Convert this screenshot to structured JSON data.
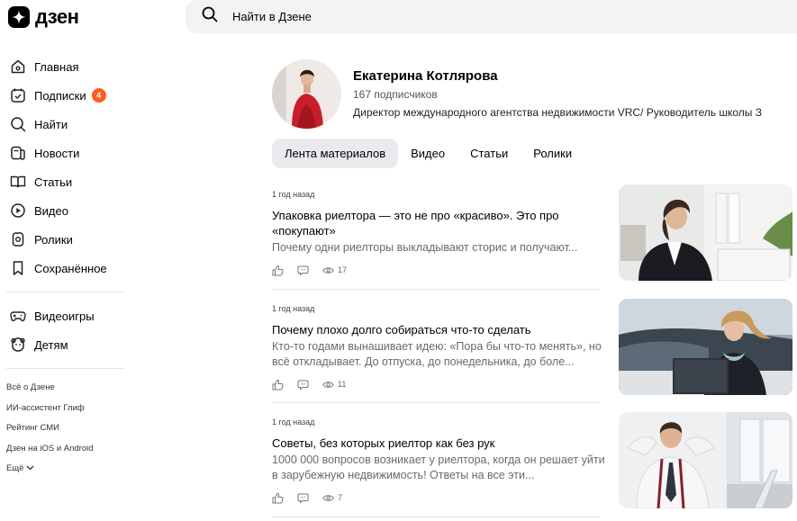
{
  "header": {
    "logo_text": "дзен",
    "search_placeholder": "Найти в Дзене"
  },
  "sidebar": {
    "items": [
      {
        "label": "Главная",
        "icon": "home-icon"
      },
      {
        "label": "Подписки",
        "icon": "subscriptions-icon",
        "badge": "4"
      },
      {
        "label": "Найти",
        "icon": "search-icon"
      },
      {
        "label": "Новости",
        "icon": "news-icon"
      },
      {
        "label": "Статьи",
        "icon": "articles-icon"
      },
      {
        "label": "Видео",
        "icon": "video-icon"
      },
      {
        "label": "Ролики",
        "icon": "shorts-icon"
      },
      {
        "label": "Сохранённое",
        "icon": "bookmark-icon"
      }
    ],
    "extra_items": [
      {
        "label": "Видеоигры",
        "icon": "gamepad-icon"
      },
      {
        "label": "Детям",
        "icon": "kids-icon"
      }
    ],
    "footer_links": [
      "Всё о Дзене",
      "ИИ-ассистент Глиф",
      "Рейтинг СМИ",
      "Дзен на iOS и Android"
    ],
    "more_label": "Ещё"
  },
  "profile": {
    "name": "Екатерина Котлярова",
    "subscribers": "167 подписчиков",
    "bio": "Директор международного агентства недвижимости VRC/ Руководитель школы З"
  },
  "tabs": [
    {
      "label": "Лента материалов",
      "active": true
    },
    {
      "label": "Видео",
      "active": false
    },
    {
      "label": "Статьи",
      "active": false
    },
    {
      "label": "Ролики",
      "active": false
    }
  ],
  "posts": [
    {
      "time": "1 год назад",
      "title": "Упаковка риелтора — это не про «красиво». Это про «покупают»",
      "snippet": "Почему одни риелторы выкладывают сторис и получают...",
      "views": "17"
    },
    {
      "time": "1 год назад",
      "title": "Почему плохо долго собираться что-то сделать",
      "snippet": "Кто-то годами вынашивает идею: «Пора бы что-то менять», но всё откладывает. До отпуска, до понедельника, до боле...",
      "views": "11"
    },
    {
      "time": "1 год назад",
      "title": "Советы, без которых риелтор как без рук",
      "snippet": "1000 000 вопросов возникает у риелтора, когда он решает уйти в зарубежную недвижимость! Ответы на все эти...",
      "views": "7"
    }
  ],
  "colors": {
    "accent_badge": "#ff5c1f",
    "search_bg": "#f2f3f5",
    "tab_active_bg": "#e9eaee"
  }
}
